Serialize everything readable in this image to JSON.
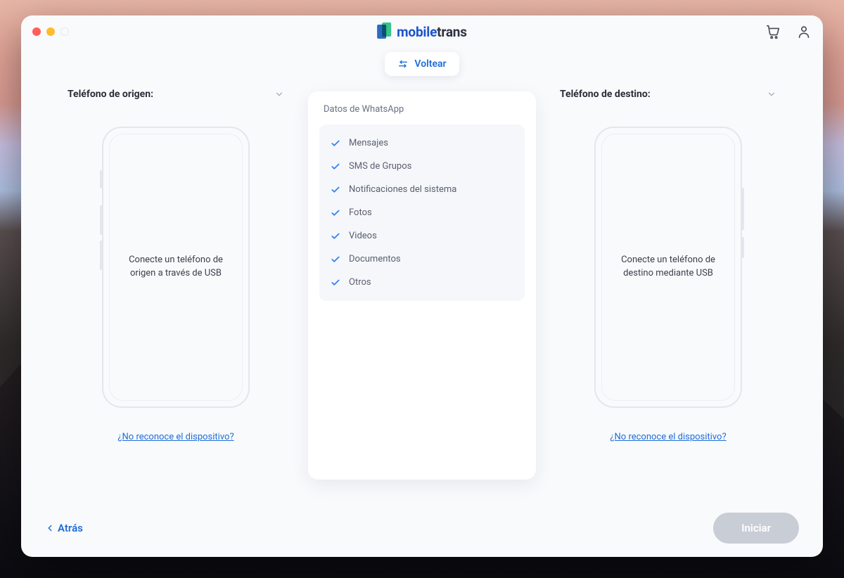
{
  "brand": {
    "part1": "mobile",
    "part2": "trans"
  },
  "flip_label": "Voltear",
  "source": {
    "title": "Teléfono de origen:",
    "prompt": "Conecte un teléfono de origen a través de USB",
    "help": "¿No reconoce el dispositivo?"
  },
  "destination": {
    "title": "Teléfono de destino:",
    "prompt": "Conecte un teléfono de destino mediante USB",
    "help": "¿No reconoce el dispositivo?"
  },
  "data_section": {
    "title": "Datos de WhatsApp",
    "items": [
      "Mensajes",
      "SMS de Grupos",
      "Notificaciones del sistema",
      "Fotos",
      "Videos",
      "Documentos",
      "Otros"
    ]
  },
  "footer": {
    "back": "Atrás",
    "start": "Iniciar"
  }
}
